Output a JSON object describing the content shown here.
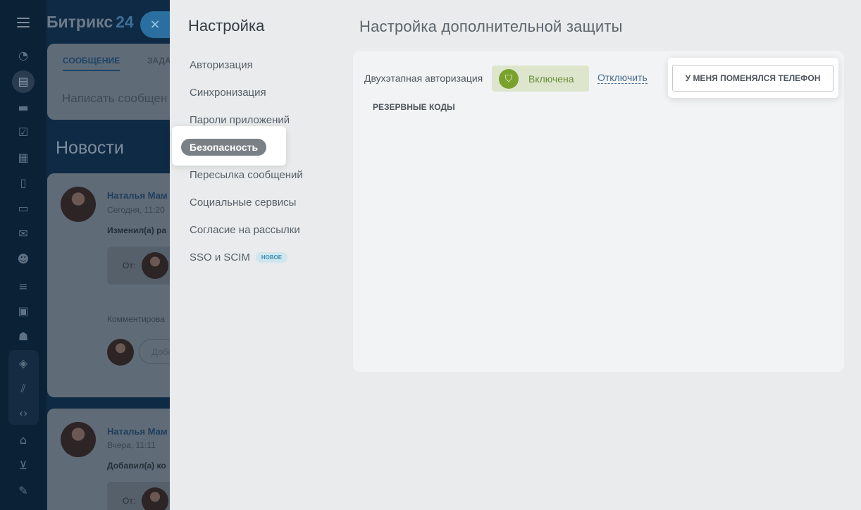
{
  "portal": {
    "logo_text": "Битрикс",
    "logo_number": "24",
    "close_icon": "×"
  },
  "rail": {
    "icons": [
      "chart-icon",
      "feed-icon",
      "chat-icon",
      "tasks-icon",
      "calendar-icon",
      "docs-icon",
      "drive-icon",
      "mail-icon",
      "groups-icon",
      "crm-icon",
      "contacts-icon",
      "robot-icon",
      "box-icon",
      "marketing-icon",
      "dev-icon",
      "bank-icon",
      "cart-icon",
      "sign-icon"
    ]
  },
  "composer": {
    "tab_message": "СООБЩЕНИЕ",
    "tab_task": "ЗАДА",
    "placeholder": "Написать сообщен"
  },
  "news": {
    "title": "Новости",
    "posts": [
      {
        "author": "Наталья Мам",
        "time": "Сегодня, 11:20",
        "action": "Изменил(а) ра",
        "from_label": "От:",
        "comment_label": "Комментирова",
        "comment_placeholder": "Доба"
      },
      {
        "author": "Наталья Мам",
        "time": "Вчера, 11:11",
        "action": "Добавил(а) ко",
        "from_label": "От:"
      }
    ]
  },
  "settings": {
    "title": "Настройка",
    "menu": [
      "Авторизация",
      "Синхронизация",
      "Пароли приложений",
      "Безопасность",
      "Пересылка сообщений",
      "Социальные сервисы",
      "Согласие на рассылки",
      "SSO и SCIM"
    ],
    "active_item": "Безопасность",
    "new_badge": "НОВОЕ"
  },
  "security": {
    "title": "Настройка дополнительной защиты",
    "twofa_label": "Двухэтапная авторизация",
    "status_text": "Включена",
    "disable_link": "Отключить",
    "phone_button": "У МЕНЯ ПОМЕНЯЛСЯ ТЕЛЕФОН",
    "backup_codes": "РЕЗЕРВНЫЕ КОДЫ"
  }
}
